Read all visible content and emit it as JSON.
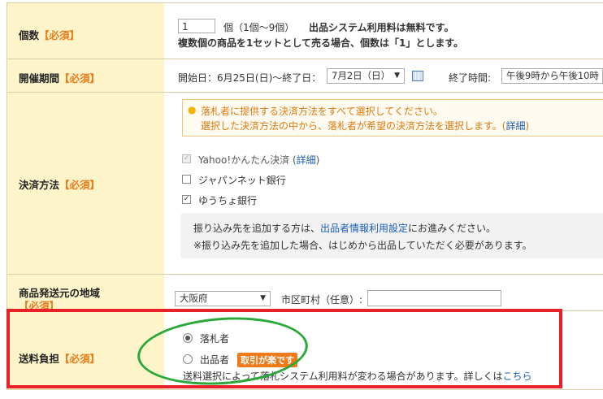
{
  "rows": {
    "quantity": {
      "label": "個数",
      "required": "【必須】",
      "input_value": "1",
      "unit_text": "個（1個〜9個）",
      "fee_note": "出品システム利用料は無料です。",
      "set_note": "複数個の商品を1セットとして売る場合、個数は「1」とします。"
    },
    "period": {
      "label": "開催期間",
      "required": "【必須】",
      "start_text": "開始日：6月25日(日)〜終了日：",
      "end_date_selected": "7月2日（日）",
      "end_time_label": "終了時間:",
      "end_time_selected": "午後9時から午後10時"
    },
    "payment": {
      "label": "決済方法",
      "required": "【必須】",
      "notice_line1": "落札者に提供する決済方法をすべて選択してください。",
      "notice_line2": "選択した決済方法の中から、落札者が希望の決済方法を選択します。(",
      "notice_link": "詳細",
      "notice_close": ")",
      "options": [
        {
          "label": "Yahoo!かんたん決済 (",
          "link": "詳細",
          "close": ")",
          "checked": true,
          "disabled": true
        },
        {
          "label": "ジャパンネット銀行",
          "checked": false,
          "disabled": false
        },
        {
          "label": "ゆうちょ銀行",
          "checked": true,
          "disabled": false
        }
      ],
      "info_line1_pre": "振り込み先を追加する方は、",
      "info_line1_link": "出品者情報利用設定",
      "info_line1_post": "にお進みください。",
      "info_line2": "※振り込み先を追加した場合、はじめから出品していただく必要があります。"
    },
    "origin": {
      "label": "商品発送元の地域",
      "required": "【必須】",
      "prefecture_selected": "大阪府",
      "city_label": "市区町村（任意）:",
      "city_value": ""
    },
    "shipping": {
      "label": "送料負担",
      "required": "【必須】",
      "options": [
        {
          "label": "落札者",
          "selected": true
        },
        {
          "label": "出品者",
          "selected": false,
          "badge": "取引が楽です"
        }
      ],
      "note_pre": "送料選択によって落札システム利用料が変わる場合があります。詳しくは",
      "note_link": "こちら"
    }
  },
  "colors": {
    "label_bg": "#fdf5c9",
    "required_orange": "#ef7a1a",
    "link_blue": "#1a5db4",
    "annotation_red": "#e8202a",
    "annotation_green": "#2aa83a"
  },
  "icons": {
    "calendar": "calendar-icon",
    "bulb": "lightbulb-icon",
    "dropdown": "chevron-down-icon"
  }
}
